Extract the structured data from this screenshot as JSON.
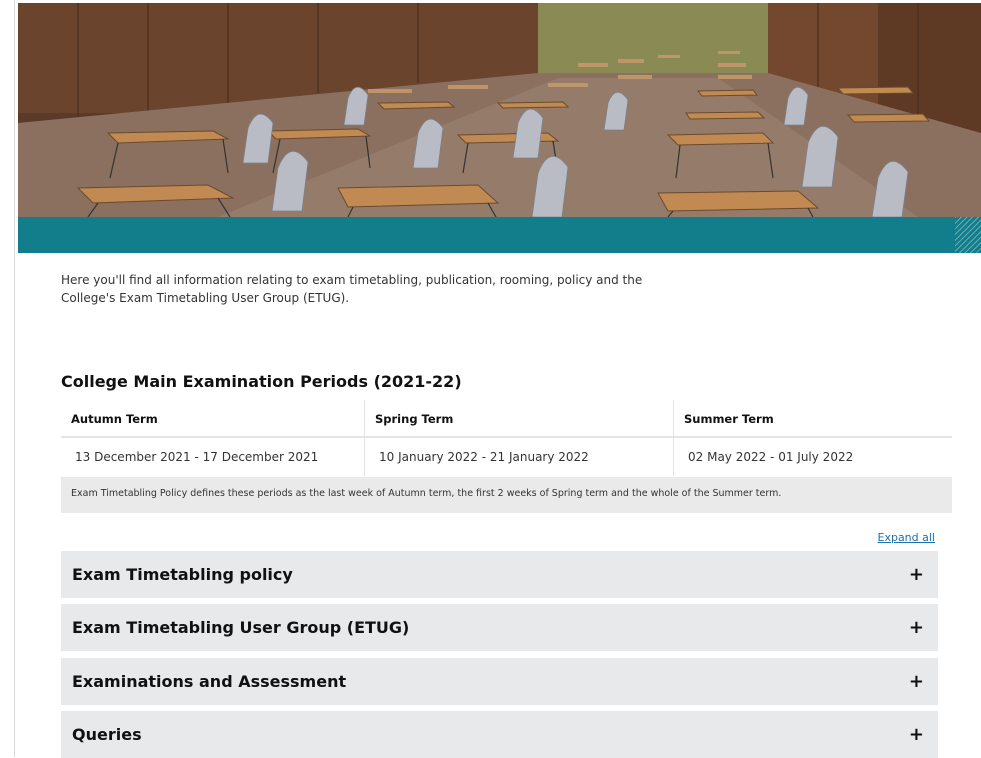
{
  "hero": {
    "image_alt": "Empty exam hall with rows of desks and chairs"
  },
  "intro": {
    "text_line1": "Here you'll find all information relating to exam timetabling, publication, rooming, policy and the",
    "text_line2": "College's Exam Timetabling User Group (ETUG)."
  },
  "periods": {
    "title": "College Main Examination Periods (2021-22)",
    "columns": [
      "Autumn Term",
      "Spring Term",
      "Summer Term"
    ],
    "dates": [
      "13 December 2021 - 17 December 2021",
      "10 January 2022 - 21 January 2022",
      "02 May 2022 - 01 July 2022"
    ],
    "note": "Exam Timetabling Policy defines these periods as the last week of Autumn term, the first 2 weeks of Spring term and the whole of the Summer term."
  },
  "expand_all": "Expand all",
  "accordion": [
    {
      "title": "Exam Timetabling policy",
      "icon": "+"
    },
    {
      "title": "Exam Timetabling User Group (ETUG)",
      "icon": "+"
    },
    {
      "title": "Examinations and Assessment",
      "icon": "+"
    },
    {
      "title": "Queries",
      "icon": "+"
    }
  ],
  "colors": {
    "teal_band": "#127d8b",
    "accordion_bg": "#e8e9ea",
    "link": "#1f6fae"
  }
}
